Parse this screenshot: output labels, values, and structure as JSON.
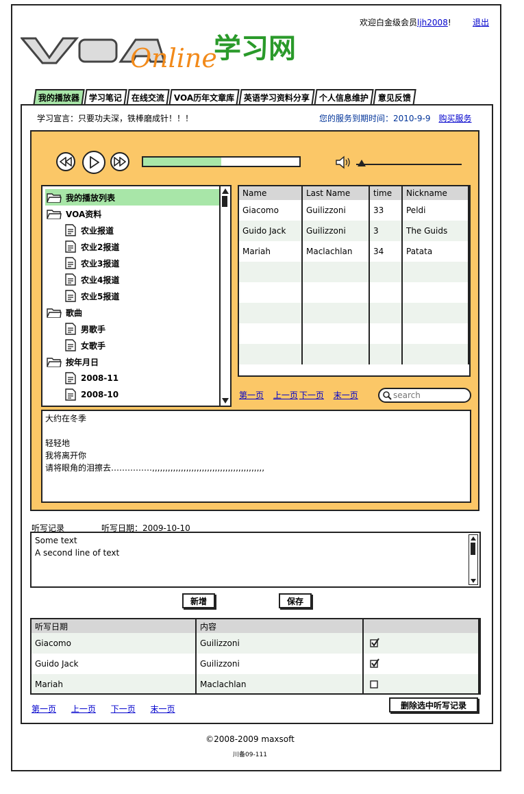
{
  "header": {
    "welcome_prefix": "欢迎白金级会员",
    "username": "ljh2008",
    "welcome_suffix": "!",
    "logout": "退出"
  },
  "logo": {
    "brand": "VOA",
    "script": "Online",
    "cn": "学习网"
  },
  "tabs": [
    "我的播放器",
    "学习笔记",
    "在线交流",
    "VOA历年文章库",
    "英语学习资料分享",
    "个人信息维护",
    "意见反馈"
  ],
  "motto": "学习宣言：只要功夫深，铁棒磨成针！！！",
  "service": {
    "label": "您的服务到期时间：2010-9-9",
    "buy": "购买服务"
  },
  "player": {
    "progress": 0.5,
    "volume": 0.04
  },
  "tree": [
    {
      "label": "我的播放列表",
      "type": "folder",
      "level": 0,
      "selected": true
    },
    {
      "label": "VOA资料",
      "type": "folder",
      "level": 0
    },
    {
      "label": "农业报道",
      "type": "file",
      "level": 1
    },
    {
      "label": "农业2报道",
      "type": "file",
      "level": 1
    },
    {
      "label": "农业3报道",
      "type": "file",
      "level": 1
    },
    {
      "label": "农业4报道",
      "type": "file",
      "level": 1
    },
    {
      "label": "农业5报道",
      "type": "file",
      "level": 1
    },
    {
      "label": "歌曲",
      "type": "folder",
      "level": 0
    },
    {
      "label": "男歌手",
      "type": "file",
      "level": 1
    },
    {
      "label": "女歌手",
      "type": "file",
      "level": 1
    },
    {
      "label": "按年月日",
      "type": "folder",
      "level": 0
    },
    {
      "label": "2008-11",
      "type": "file",
      "level": 1
    },
    {
      "label": "2008-10",
      "type": "file",
      "level": 1
    }
  ],
  "grid": {
    "headers": [
      "Name",
      "Last Name",
      "time",
      "Nickname"
    ],
    "rows": [
      [
        "Giacomo",
        "Guilizzoni",
        "33",
        "Peldi"
      ],
      [
        "Guido Jack",
        "Guilizzoni",
        "3",
        "The Guids"
      ],
      [
        "Mariah",
        "Maclachlan",
        "34",
        "Patata"
      ],
      [
        "",
        "",
        "",
        ""
      ],
      [
        "",
        "",
        "",
        ""
      ],
      [
        "",
        "",
        "",
        ""
      ],
      [
        "",
        "",
        "",
        ""
      ],
      [
        "",
        "",
        "",
        ""
      ]
    ]
  },
  "pager": {
    "first": "第一页",
    "prev": "上一页",
    "next": "下一页",
    "last": "末一页"
  },
  "search": {
    "placeholder": "search"
  },
  "lyrics": [
    "大约在冬季",
    "",
    "轻轻地",
    "我将离开你",
    "请将眼角的泪擦去……………,,,,,,,,,,,,,,,,,,,,,,,,,,,,,,,,,,,,,,,,,,,"
  ],
  "dictation": {
    "label": "听写记录",
    "date": "听写日期：2009-10-10",
    "lines": [
      "Some text",
      "A second line of text"
    ]
  },
  "buttons": {
    "add": "新增",
    "save": "保存",
    "delete": "删除选中听写记录"
  },
  "records": {
    "headers": [
      "听写日期",
      "内容",
      ""
    ],
    "rows": [
      {
        "date": "Giacomo",
        "content": "Guilizzoni",
        "checked": true
      },
      {
        "date": "Guido Jack",
        "content": "Guilizzoni",
        "checked": true
      },
      {
        "date": "Mariah",
        "content": "Maclachlan",
        "checked": false
      }
    ]
  },
  "footer": {
    "copyright": "©2008-2009 maxsoft",
    "icp": "川备09-111"
  }
}
